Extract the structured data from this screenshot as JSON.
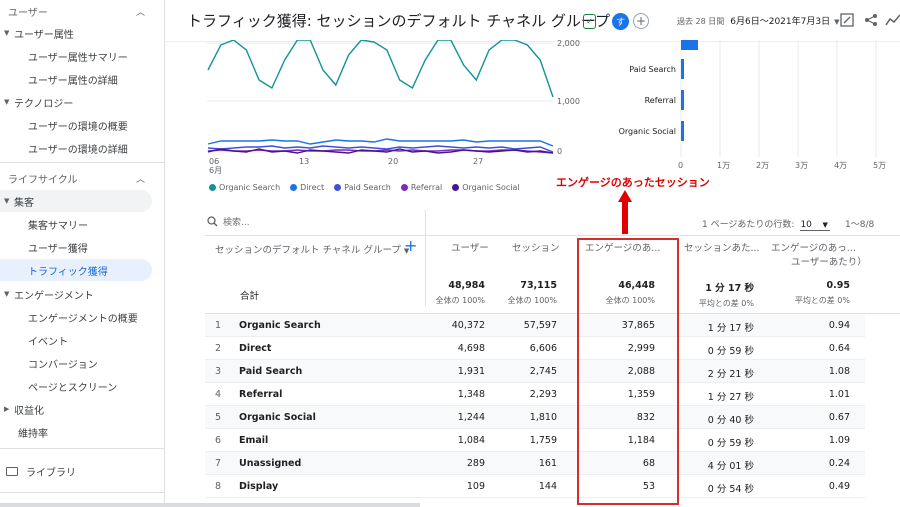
{
  "sidebar": {
    "top_item": "ユーザー",
    "items": [
      {
        "label": "ユーザー属性",
        "type": "group"
      },
      {
        "label": "ユーザー属性サマリー",
        "type": "child"
      },
      {
        "label": "ユーザー属性の詳細",
        "type": "child"
      },
      {
        "label": "テクノロジー",
        "type": "group"
      },
      {
        "label": "ユーザーの環境の概要",
        "type": "child"
      },
      {
        "label": "ユーザーの環境の詳細",
        "type": "child"
      }
    ],
    "lifecycle_label": "ライフサイクル",
    "acquisition": {
      "label": "集客",
      "children": [
        "集客サマリー",
        "ユーザー獲得",
        "トラフィック獲得"
      ]
    },
    "engagement": {
      "label": "エンゲージメント",
      "children": [
        "エンゲージメントの概要",
        "イベント",
        "コンバージョン",
        "ページとスクリーン"
      ]
    },
    "monetization": "収益化",
    "retention": "維持率",
    "library": "ライブラリ"
  },
  "header": {
    "title": "トラフィック獲得: セッションのデフォルト チャネル グループ",
    "avatar_letter": "す",
    "date_prefix": "過去 28 日間",
    "date_value": "6月6日～2021年7月3日"
  },
  "line_chart": {
    "y_ticks": [
      "2,000",
      "1,000",
      "0"
    ],
    "x_ticks": [
      "06",
      "13",
      "20",
      "27"
    ],
    "x_month": "6月"
  },
  "bar_chart": {
    "categories": [
      "Paid Search",
      "Referral",
      "Organic Social"
    ],
    "x_ticks": [
      "0",
      "1万",
      "2万",
      "3万",
      "4万",
      "5万"
    ]
  },
  "chart_data": {
    "type": "line",
    "x_ticks": [
      "06",
      "13",
      "20",
      "27"
    ],
    "series": [
      {
        "name": "Organic Search",
        "color": "#12939a"
      },
      {
        "name": "Direct",
        "color": "#1a73e8"
      },
      {
        "name": "Paid Search",
        "color": "#3f51d8"
      },
      {
        "name": "Referral",
        "color": "#7b2cbf"
      },
      {
        "name": "Organic Social",
        "color": "#4a148c"
      }
    ]
  },
  "legend": [
    "Organic Search",
    "Direct",
    "Paid Search",
    "Referral",
    "Organic Social"
  ],
  "colors": {
    "organic_search": "#12939a",
    "direct": "#1a73e8",
    "paid_search": "#3f51d8",
    "referral": "#7b2cbf",
    "organic_social": "#4a148c",
    "annotation": "#e00000"
  },
  "annotation": "エンゲージのあったセッション",
  "table": {
    "search_placeholder": "検索...",
    "rows_per_page_label": "1 ページあたりの行数:",
    "rows_per_page_value": "10",
    "pagination": "1〜8/8",
    "dimension_header": "セッションのデフォルト チャネル グループ",
    "headers": [
      "ユーザー",
      "セッション",
      "エンゲージのあ...",
      "セッションあた...",
      "エンゲージのあっ..."
    ],
    "header_sub": "ユーザーあたり）",
    "totals": {
      "label": "合計",
      "values": [
        "48,984",
        "73,115",
        "46,448",
        "1 分 17 秒",
        "0.95"
      ],
      "subs": [
        "全体の 100%",
        "全体の 100%",
        "全体の 100%",
        "平均との差 0%",
        "平均との差 0%"
      ]
    },
    "rows": [
      {
        "idx": "1",
        "name": "Organic Search",
        "users": "40,372",
        "sessions": "57,597",
        "engaged": "37,865",
        "duration": "1 分 17 秒",
        "per_user": "0.94"
      },
      {
        "idx": "2",
        "name": "Direct",
        "users": "4,698",
        "sessions": "6,606",
        "engaged": "2,999",
        "duration": "0 分 59 秒",
        "per_user": "0.64"
      },
      {
        "idx": "3",
        "name": "Paid Search",
        "users": "1,931",
        "sessions": "2,745",
        "engaged": "2,088",
        "duration": "2 分 21 秒",
        "per_user": "1.08"
      },
      {
        "idx": "4",
        "name": "Referral",
        "users": "1,348",
        "sessions": "2,293",
        "engaged": "1,359",
        "duration": "1 分 27 秒",
        "per_user": "1.01"
      },
      {
        "idx": "5",
        "name": "Organic Social",
        "users": "1,244",
        "sessions": "1,810",
        "engaged": "832",
        "duration": "0 分 40 秒",
        "per_user": "0.67"
      },
      {
        "idx": "6",
        "name": "Email",
        "users": "1,084",
        "sessions": "1,759",
        "engaged": "1,184",
        "duration": "0 分 59 秒",
        "per_user": "1.09"
      },
      {
        "idx": "7",
        "name": "Unassigned",
        "users": "289",
        "sessions": "161",
        "engaged": "68",
        "duration": "4 分 01 秒",
        "per_user": "0.24"
      },
      {
        "idx": "8",
        "name": "Display",
        "users": "109",
        "sessions": "144",
        "engaged": "53",
        "duration": "0 分 54 秒",
        "per_user": "0.49"
      }
    ]
  }
}
